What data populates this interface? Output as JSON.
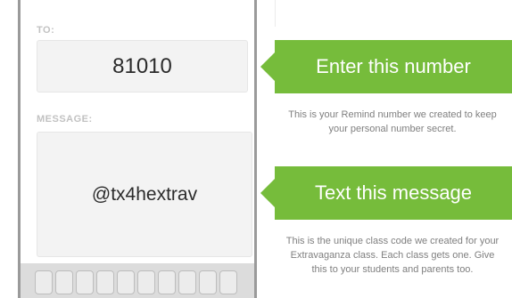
{
  "phone": {
    "to_label": "TO:",
    "to_value": "81010",
    "message_label": "MESSAGE:",
    "message_value": "@tx4hextrav"
  },
  "annotations": [
    {
      "title": "Enter this number",
      "description": "This is your Remind number we created to keep your personal number secret."
    },
    {
      "title": "Text this message",
      "description": "This is the unique class code we created for your Extravaganza class. Each class gets one. Give this to your students and parents too."
    }
  ],
  "colors": {
    "accent": "#76bc3b",
    "phone_frame": "#9a9a9a",
    "field_bg": "#f3f3f3",
    "label": "#c2c2c2",
    "description": "#7f7f7f"
  }
}
